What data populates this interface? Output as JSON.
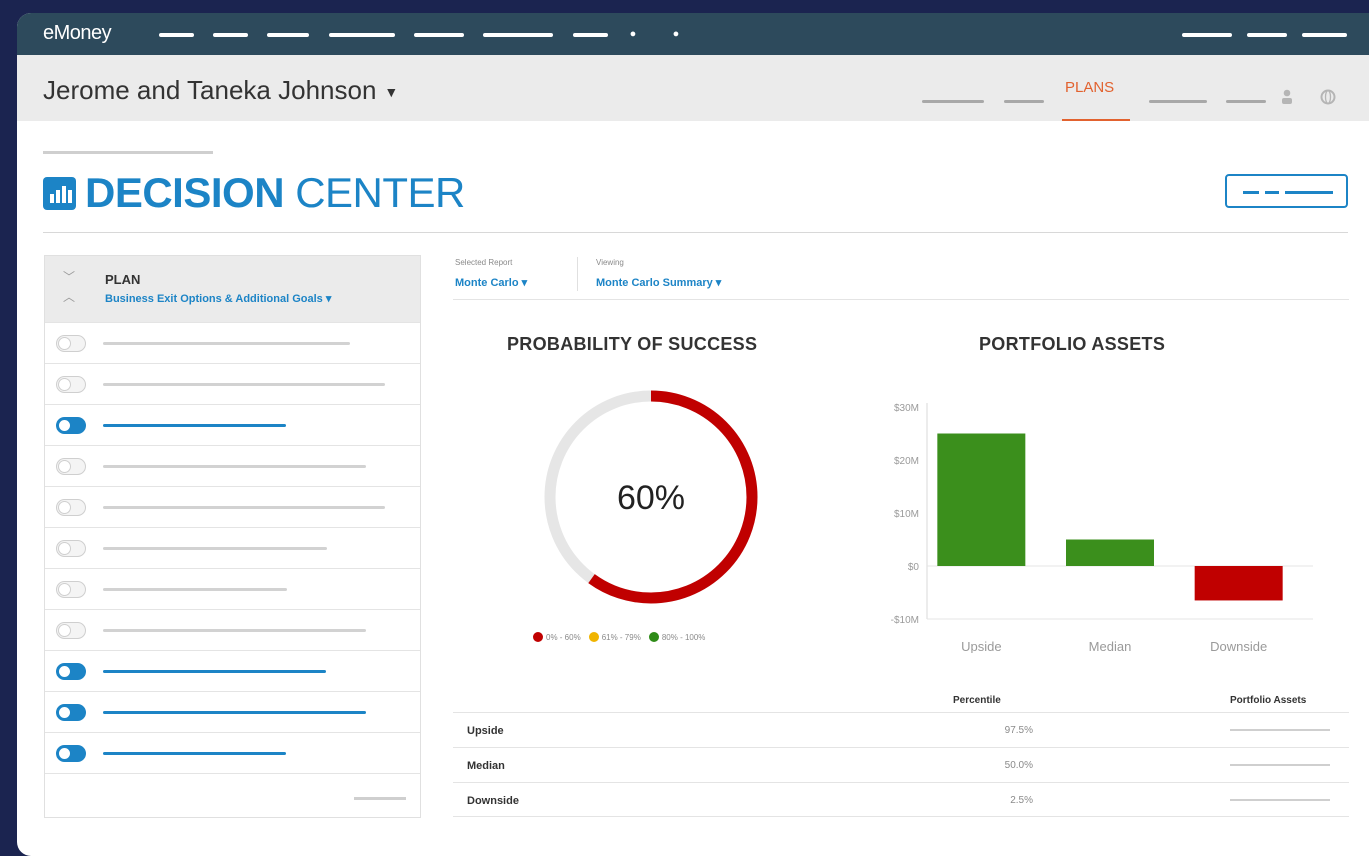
{
  "app": {
    "brand": "eMoney"
  },
  "header": {
    "client_name": "Jerome and Taneka Johnson",
    "active_nav": "PLANS"
  },
  "page": {
    "title_bold": "DECISION",
    "title_rest": "CENTER"
  },
  "plan_panel": {
    "heading": "PLAN",
    "selected_plan": "Business Exit Options & Additional Goals",
    "toggles": [
      false,
      false,
      true,
      false,
      false,
      false,
      false,
      false,
      true,
      true,
      true
    ]
  },
  "report": {
    "selected_label": "Selected Report",
    "selected_value": "Monte Carlo",
    "viewing_label": "Viewing",
    "viewing_value": "Monte Carlo Summary"
  },
  "probability": {
    "title": "PROBABILITY OF SUCCESS",
    "value": 60,
    "display": "60%",
    "legend": [
      {
        "label": "0% - 60%",
        "color": "#c00000"
      },
      {
        "label": "61% - 79%",
        "color": "#f0b400"
      },
      {
        "label": "80% - 100%",
        "color": "#2e8b17"
      }
    ]
  },
  "chart_data": {
    "type": "bar",
    "title": "PORTFOLIO ASSETS",
    "categories": [
      "Upside",
      "Median",
      "Downside"
    ],
    "values": [
      25,
      5,
      -6.5
    ],
    "colors": [
      "#3b8f1c",
      "#3b8f1c",
      "#c00000"
    ],
    "ylim": [
      -10,
      30
    ],
    "yticks": [
      -10,
      0,
      10,
      20,
      30
    ],
    "ytick_labels": [
      "-$10M",
      "$0",
      "$10M",
      "$20M",
      "$30M"
    ],
    "xlabel": "",
    "ylabel": ""
  },
  "table": {
    "headers": {
      "percentile": "Percentile",
      "assets": "Portfolio Assets"
    },
    "rows": [
      {
        "name": "Upside",
        "percentile": "97.5%"
      },
      {
        "name": "Median",
        "percentile": "50.0%"
      },
      {
        "name": "Downside",
        "percentile": "2.5%"
      }
    ]
  }
}
